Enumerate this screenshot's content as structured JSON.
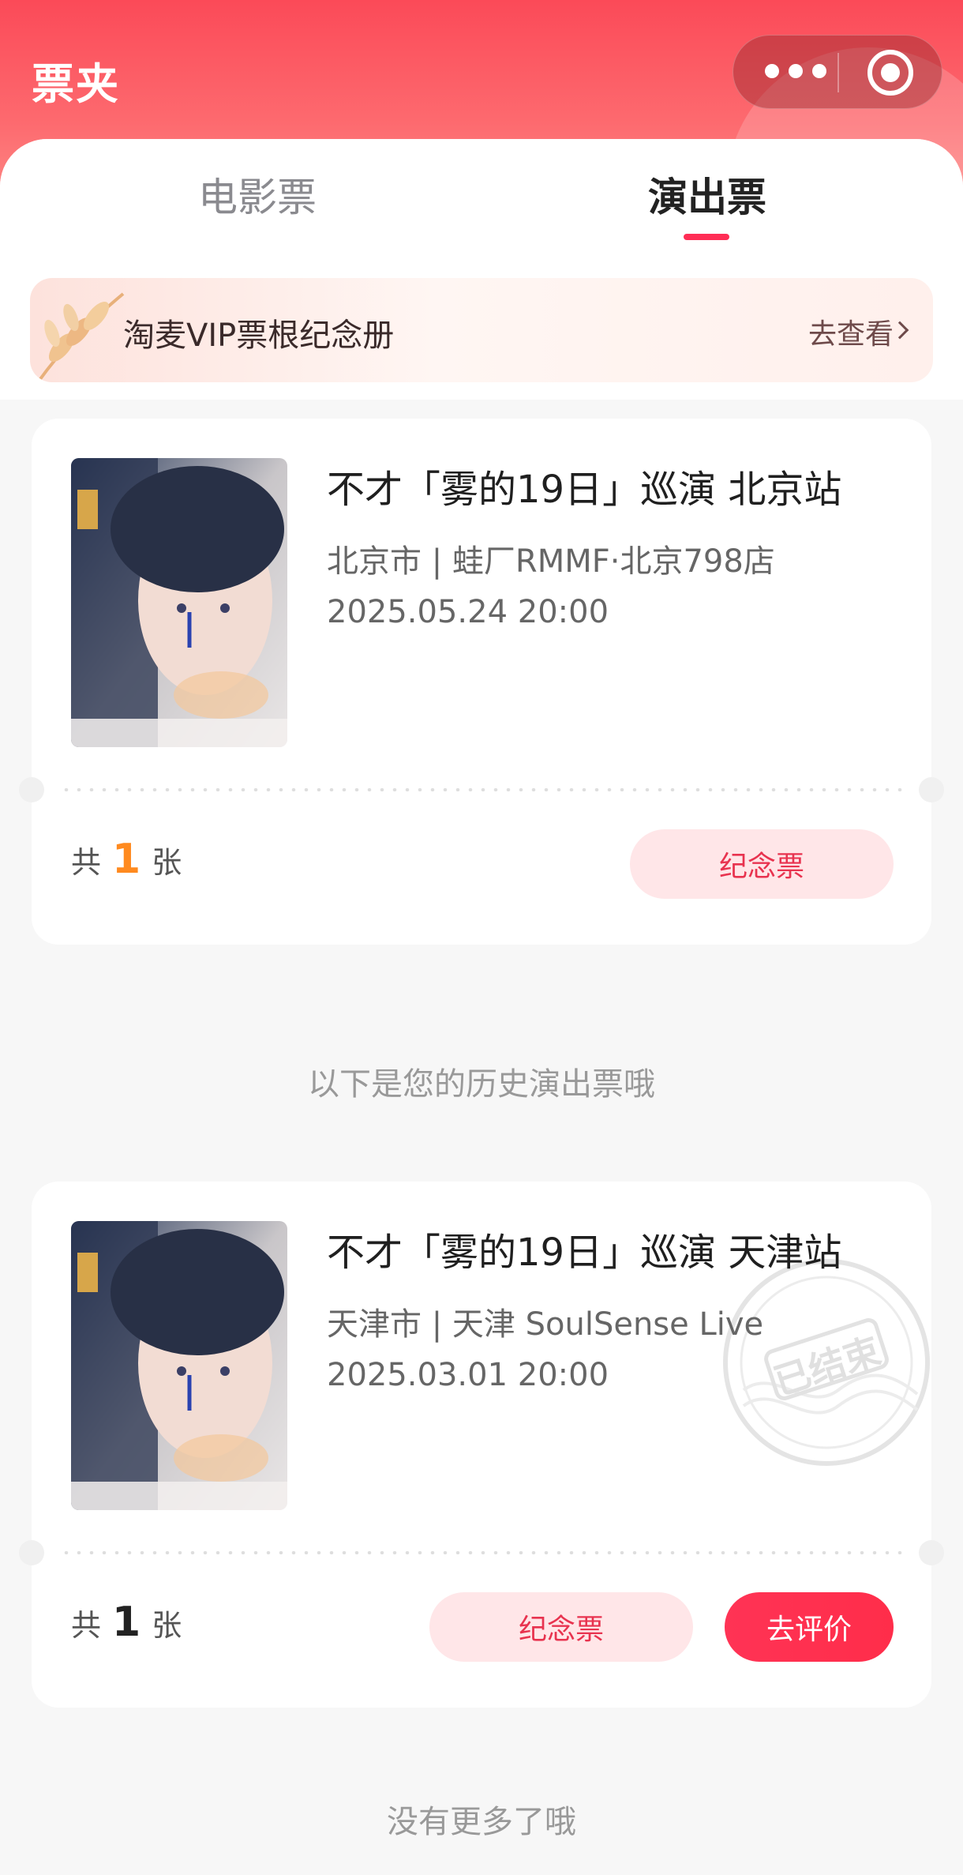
{
  "header": {
    "title": "票夹"
  },
  "tabs": [
    {
      "label": "电影票",
      "active": false
    },
    {
      "label": "演出票",
      "active": true
    }
  ],
  "vip_banner": {
    "text": "淘麦VIP票根纪念册",
    "link": "去查看"
  },
  "tickets": [
    {
      "title": "不才「雾的19日」巡演 北京站",
      "venue": "北京市 | 蛙厂RMMF·北京798店",
      "time": "2025.05.24 20:00",
      "count_prefix": "共",
      "count": "1",
      "count_suffix": "张",
      "buttons": [
        "纪念票"
      ],
      "status": null
    },
    {
      "title": "不才「雾的19日」巡演 天津站",
      "venue": "天津市 | 天津 SoulSense Live",
      "time": "2025.03.01 20:00",
      "count_prefix": "共",
      "count": "1",
      "count_suffix": "张",
      "buttons": [
        "纪念票",
        "去评价"
      ],
      "status": "已结束"
    }
  ],
  "history_note": "以下是您的历史演出票哦",
  "end_note": "没有更多了哦",
  "colors": {
    "header": "#fb4a58",
    "accent": "#ff2d55",
    "count_highlight": "#ff8a1f"
  }
}
